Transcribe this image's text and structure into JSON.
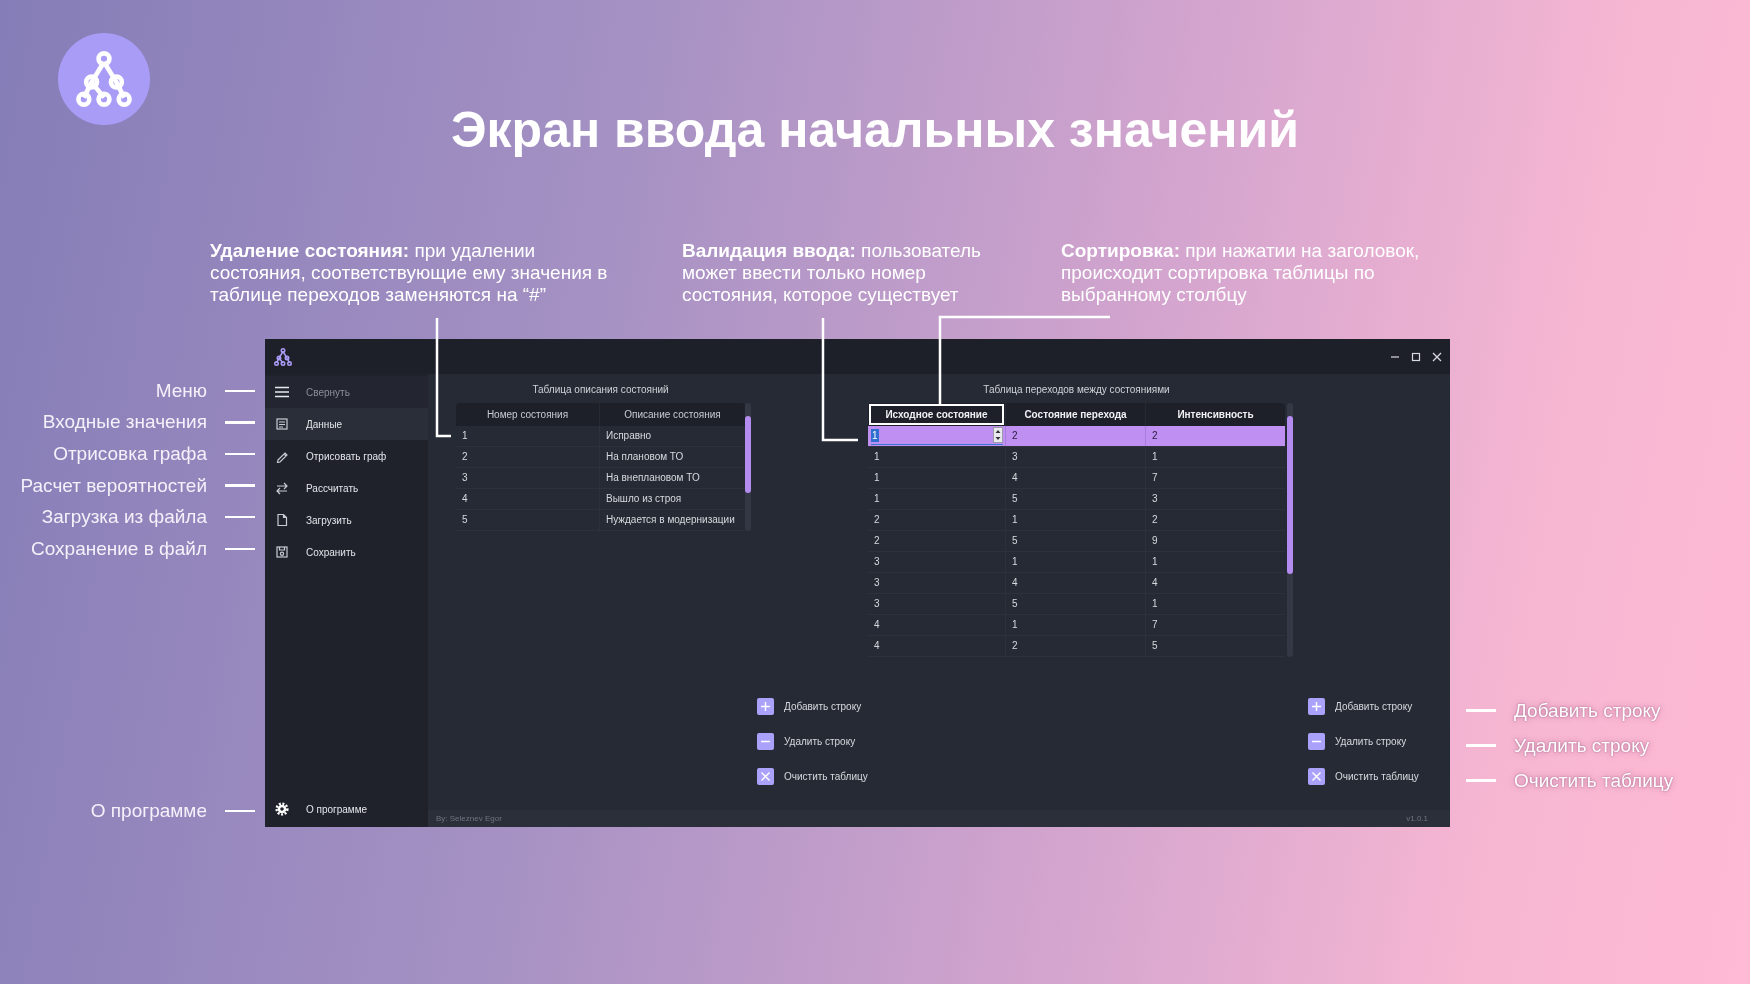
{
  "title": "Экран ввода начальных значений",
  "notes": [
    {
      "text": "**Удаление состояния:** при удалении состояния, соответствующие ему значения в таблице переходов заменяются на “#”"
    },
    {
      "text": "**Валидация ввода:** пользователь может ввести только номер состояния, которое существует"
    },
    {
      "text": "**Сортировка:** при нажатии на заголовок, происходит сортировка таблицы по выбранному столбцу"
    }
  ],
  "menu_labels": [
    "Меню",
    "Входные значения",
    "Отрисовка графа",
    "Расчет вероятностей",
    "Загрузка из файла",
    "Сохранение в файл"
  ],
  "about_label": "О программе",
  "button_labels": [
    "Добавить строку",
    "Удалить строку",
    "Очистить таблицу"
  ],
  "app": {
    "sidebar": {
      "collapse": "Свернуть",
      "items": [
        {
          "label": "Данные",
          "selected": true
        },
        {
          "label": "Отрисовать граф",
          "selected": false
        },
        {
          "label": "Рассчитать",
          "selected": false
        },
        {
          "label": "Загрузить",
          "selected": false
        },
        {
          "label": "Сохранить",
          "selected": false
        }
      ],
      "about": "О программе"
    },
    "states_table": {
      "title": "Таблица описания состояний",
      "columns": [
        "Номер состояния",
        "Описание состояния"
      ],
      "rows": [
        [
          "1",
          "Исправно"
        ],
        [
          "2",
          "На плановом ТО"
        ],
        [
          "3",
          "На внеплановом ТО"
        ],
        [
          "4",
          "Вышло из строя"
        ],
        [
          "5",
          "Нуждается в модернизации"
        ]
      ]
    },
    "state_buttons": [
      "Добавить строку",
      "Удалить строку",
      "Очистить таблицу"
    ],
    "transitions_table": {
      "title": "Таблица переходов между состояниями",
      "columns": [
        {
          "label": "Исходное состояние",
          "highlighted": true
        },
        {
          "label": "Состояние перехода",
          "highlighted": false
        },
        {
          "label": "Интенсивность",
          "highlighted": false
        }
      ],
      "rows": [
        {
          "cells": [
            "1",
            "2",
            "2"
          ],
          "selected": true,
          "editing": true
        },
        {
          "cells": [
            "1",
            "3",
            "1"
          ],
          "selected": false,
          "editing": false
        },
        {
          "cells": [
            "1",
            "4",
            "7"
          ],
          "selected": false,
          "editing": false
        },
        {
          "cells": [
            "1",
            "5",
            "3"
          ],
          "selected": false,
          "editing": false
        },
        {
          "cells": [
            "2",
            "1",
            "2"
          ],
          "selected": false,
          "editing": false
        },
        {
          "cells": [
            "2",
            "5",
            "9"
          ],
          "selected": false,
          "editing": false
        },
        {
          "cells": [
            "3",
            "1",
            "1"
          ],
          "selected": false,
          "editing": false
        },
        {
          "cells": [
            "3",
            "4",
            "4"
          ],
          "selected": false,
          "editing": false
        },
        {
          "cells": [
            "3",
            "5",
            "1"
          ],
          "selected": false,
          "editing": false
        },
        {
          "cells": [
            "4",
            "1",
            "7"
          ],
          "selected": false,
          "editing": false
        },
        {
          "cells": [
            "4",
            "2",
            "5"
          ],
          "selected": false,
          "editing": false
        }
      ]
    },
    "transition_buttons": [
      "Добавить строку",
      "Удалить строку",
      "Очистить таблицу"
    ],
    "footer": {
      "author": "By: Seleznev Egor",
      "version": "v1.0.1"
    }
  }
}
